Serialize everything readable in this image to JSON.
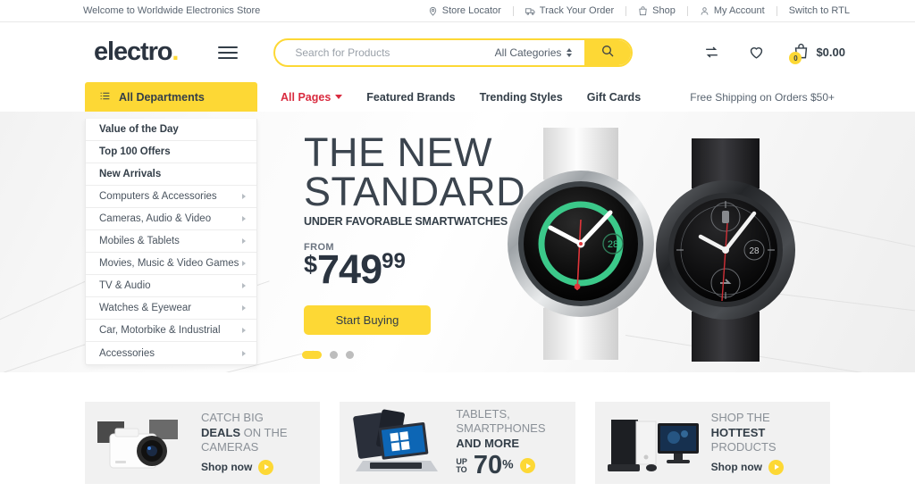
{
  "topbar": {
    "welcome": "Welcome to Worldwide Electronics Store",
    "links": [
      {
        "label": "Store Locator",
        "icon": "map-pin-icon"
      },
      {
        "label": "Track Your Order",
        "icon": "delivery-truck-icon"
      },
      {
        "label": "Shop",
        "icon": "shopping-bag-icon"
      },
      {
        "label": "My Account",
        "icon": "user-icon"
      },
      {
        "label": "Switch to RTL",
        "icon": ""
      }
    ]
  },
  "header": {
    "logo": "electro",
    "logo_dot": ".",
    "menu_icon": "hamburger-menu-icon",
    "search": {
      "placeholder": "Search for Products",
      "value": "",
      "category": "All Categories",
      "button_icon": "search-icon"
    },
    "compare_icon": "compare-arrows-icon",
    "wishlist_icon": "heart-icon",
    "cart": {
      "icon": "shopping-bag-icon",
      "count": "0",
      "total": "$0.00"
    }
  },
  "nav": {
    "departments_label": "All Departments",
    "departments_icon": "list-icon",
    "links": [
      {
        "label": "All Pages",
        "active": true,
        "has_chevron": true
      },
      {
        "label": "Featured Brands",
        "active": false,
        "has_chevron": false
      },
      {
        "label": "Trending Styles",
        "active": false,
        "has_chevron": false
      },
      {
        "label": "Gift Cards",
        "active": false,
        "has_chevron": false
      }
    ],
    "note": "Free Shipping on Orders $50+"
  },
  "departments": [
    {
      "label": "Value of the Day",
      "strong": true,
      "chevron": false
    },
    {
      "label": "Top 100 Offers",
      "strong": true,
      "chevron": false
    },
    {
      "label": "New Arrivals",
      "strong": true,
      "chevron": false
    },
    {
      "label": "Computers & Accessories",
      "strong": false,
      "chevron": true
    },
    {
      "label": "Cameras, Audio & Video",
      "strong": false,
      "chevron": true
    },
    {
      "label": "Mobiles & Tablets",
      "strong": false,
      "chevron": true
    },
    {
      "label": "Movies, Music & Video Games",
      "strong": false,
      "chevron": true
    },
    {
      "label": "TV & Audio",
      "strong": false,
      "chevron": true
    },
    {
      "label": "Watches & Eyewear",
      "strong": false,
      "chevron": true
    },
    {
      "label": "Car, Motorbike & Industrial",
      "strong": false,
      "chevron": true
    },
    {
      "label": "Accessories",
      "strong": false,
      "chevron": true
    }
  ],
  "hero": {
    "title_line1": "THE NEW",
    "title_line2": "STANDARD",
    "subtitle": "UNDER FAVORABLE SMARTWATCHES",
    "from_label": "FROM",
    "currency": "$",
    "price_int": "749",
    "price_dec": "99",
    "cta": "Start Buying",
    "slides": 3,
    "active_slide": 1,
    "watch_date_silver": "28",
    "watch_date_black": "28"
  },
  "promos": [
    {
      "line1": "CATCH BIG",
      "line2_bold": "DEALS",
      "line2_rest": " ON THE",
      "line3": "CAMERAS",
      "cta": "Shop now",
      "art": "camera-product-image",
      "type": "shopnow"
    },
    {
      "line1": "TABLETS,",
      "line2_bold": "",
      "line2_rest": "SMARTPHONES",
      "line3_bold": "AND MORE",
      "upto_1": "UP",
      "upto_2": "TO",
      "percent": "70",
      "percent_symbol": "%",
      "art": "laptop-tablet-product-image",
      "type": "percent"
    },
    {
      "line1": "SHOP THE",
      "line2_bold": "HOTTEST",
      "line2_rest": "",
      "line3": "PRODUCTS",
      "cta": "Shop now",
      "art": "desktop-computer-product-image",
      "type": "shopnow"
    }
  ],
  "colors": {
    "accent_yellow": "#FDD835",
    "active_link_red": "#D92B3F",
    "text_dark": "#333E48",
    "text_muted": "#8A9097",
    "watch_ring_green": "#3BC98A"
  }
}
